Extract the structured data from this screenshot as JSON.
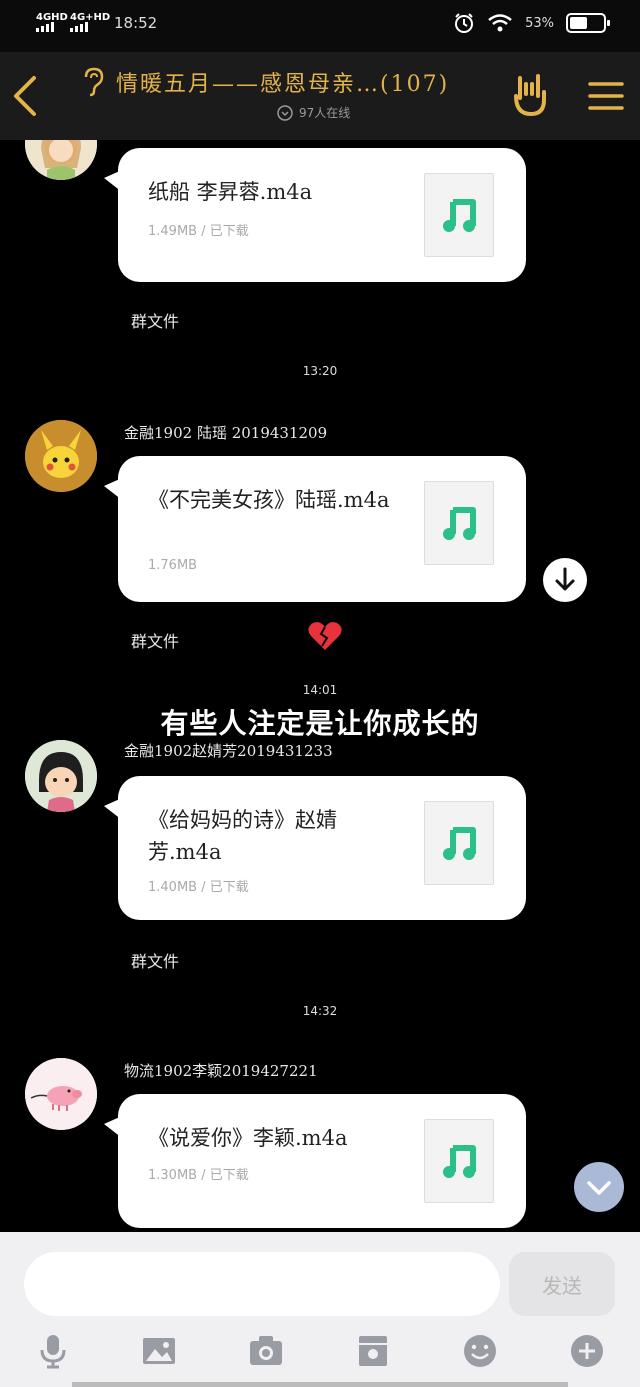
{
  "status_bar": {
    "network_1": "4GHD",
    "network_2": "4G+HD",
    "time": "18:52",
    "battery_pct": "53%",
    "battery_level": 0.53
  },
  "header": {
    "title": "情暖五月——感恩母亲…(107)",
    "online": "97人在线"
  },
  "messages": [
    {
      "file_name": "纸船 李昇蓉.m4a",
      "file_meta": "1.49MB / 已下载",
      "group_file": "群文件"
    },
    {
      "timestamp": "13:20",
      "sender": "金融1902 陆瑶 2019431209",
      "file_name": "《不完美女孩》陆瑶.m4a",
      "file_meta": "1.76MB",
      "group_file": "群文件"
    },
    {
      "timestamp": "14:01",
      "overlay_text": "有些人注定是让你成长的",
      "sender": "金融1902赵婧芳2019431233",
      "file_name": "《给妈妈的诗》赵婧芳.m4a",
      "file_meta": "1.40MB / 已下载",
      "group_file": "群文件"
    },
    {
      "timestamp": "14:32",
      "sender": "物流1902李颖2019427221",
      "file_name": "《说爱你》李颖.m4a",
      "file_meta": "1.30MB / 已下载"
    }
  ],
  "input": {
    "placeholder": "",
    "send_label": "发送"
  },
  "colors": {
    "accent_gold": "#e3b349",
    "music_green": "#2bbf8a"
  },
  "icons": [
    "back-icon",
    "ear-icon",
    "hand-icon",
    "menu-icon",
    "music-icon",
    "broken-heart-icon",
    "down-arrow-icon",
    "chevron-down-icon",
    "mic-icon",
    "image-icon",
    "camera-icon",
    "file-icon",
    "emoji-icon",
    "plus-icon"
  ]
}
